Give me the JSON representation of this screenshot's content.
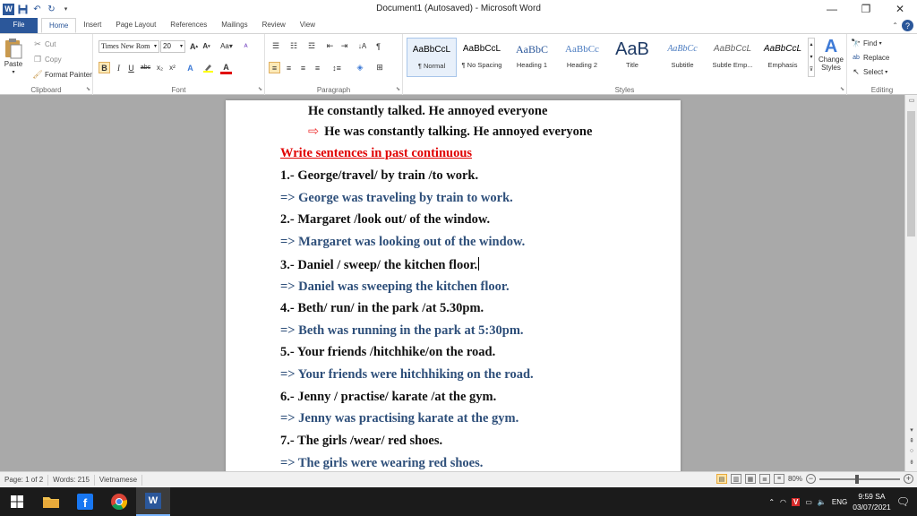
{
  "window": {
    "title": "Document1 (Autosaved)  -  Microsoft Word",
    "minimize": "—",
    "restore": "❐",
    "close": "✕"
  },
  "tabs": [
    {
      "label": "File"
    },
    {
      "label": "Home"
    },
    {
      "label": "Insert"
    },
    {
      "label": "Page Layout"
    },
    {
      "label": "References"
    },
    {
      "label": "Mailings"
    },
    {
      "label": "Review"
    },
    {
      "label": "View"
    }
  ],
  "ribbon": {
    "clipboard": {
      "label": "Clipboard",
      "paste": "Paste",
      "cut": "Cut",
      "copy": "Copy",
      "format_painter": "Format Painter"
    },
    "font": {
      "label": "Font",
      "font_name": "Times New Rom",
      "font_size": "20"
    },
    "paragraph": {
      "label": "Paragraph"
    },
    "styles": {
      "label": "Styles",
      "items": [
        {
          "sample": "AaBbCcL",
          "name": "¶ Normal"
        },
        {
          "sample": "AaBbCcL",
          "name": "¶ No Spacing"
        },
        {
          "sample": "AaBbC",
          "name": "Heading 1"
        },
        {
          "sample": "AaBbCc",
          "name": "Heading 2"
        },
        {
          "sample": "AaB",
          "name": "Title"
        },
        {
          "sample": "AaBbCc",
          "name": "Subtitle"
        },
        {
          "sample": "AaBbCcL",
          "name": "Subtle Emp..."
        },
        {
          "sample": "AaBbCcL",
          "name": "Emphasis"
        }
      ],
      "change_styles": "Change Styles"
    },
    "editing": {
      "label": "Editing",
      "find": "Find",
      "replace": "Replace",
      "select": "Select"
    }
  },
  "document": {
    "lines": [
      {
        "text": "He constantly talked. He annoyed everyone",
        "kind": "plain",
        "indent": 1
      },
      {
        "text": "He was constantly talking. He annoyed everyone",
        "kind": "arrow",
        "indent": 1
      },
      {
        "text": "Write sentences in past continuous",
        "kind": "heading",
        "indent": 0
      },
      {
        "text": "1.- George/travel/ by train /to work.",
        "kind": "plain",
        "indent": 0
      },
      {
        "text": "=> George was traveling by train to work.",
        "kind": "answer",
        "indent": 0
      },
      {
        "text": "2.- Margaret /look out/ of the window.",
        "kind": "plain",
        "indent": 0
      },
      {
        "text": "=> Margaret was looking out of the window.",
        "kind": "answer",
        "indent": 0
      },
      {
        "text": "3.- Daniel / sweep/ the kitchen floor.",
        "kind": "plain",
        "indent": 0
      },
      {
        "text": "=> Daniel was sweeping the kitchen floor.",
        "kind": "answer",
        "indent": 0
      },
      {
        "text": "4.- Beth/ run/ in the park /at 5.30pm.",
        "kind": "plain",
        "indent": 0
      },
      {
        "text": "=> Beth was running in the park at 5:30pm.",
        "kind": "answer",
        "indent": 0
      },
      {
        "text": "5.- Your friends /hitchhike/on the road.",
        "kind": "plain",
        "indent": 0
      },
      {
        "text": "=> Your friends were hitchhiking on the road.",
        "kind": "answer",
        "indent": 0
      },
      {
        "text": "6.- Jenny / practise/ karate /at the gym.",
        "kind": "plain",
        "indent": 0
      },
      {
        "text": "=> Jenny was practising karate at the gym.",
        "kind": "answer",
        "indent": 0
      },
      {
        "text": "7.- The girls /wear/ red shoes.",
        "kind": "plain",
        "indent": 0
      },
      {
        "text": "=> The girls were wearing red shoes.",
        "kind": "answer",
        "indent": 0
      }
    ]
  },
  "status": {
    "page": "Page: 1 of 2",
    "words": "Words: 215",
    "language": "Vietnamese",
    "zoom": "80%"
  },
  "taskbar": {
    "lang": "ENG",
    "time": "9:59 SA",
    "date": "03/07/2021"
  }
}
